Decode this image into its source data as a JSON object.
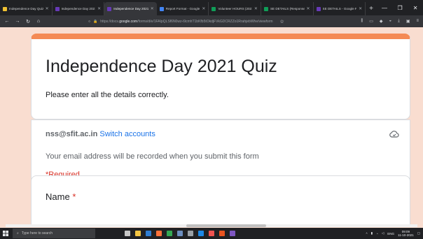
{
  "browser": {
    "tabs": [
      {
        "label": "Independence Day Quiz",
        "color": "#f1c232",
        "active": false
      },
      {
        "label": "Independence Day 2021",
        "color": "#673ab7",
        "active": false
      },
      {
        "label": "Independence Day 2021",
        "color": "#673ab7",
        "active": true
      },
      {
        "label": "Report Format - Google",
        "color": "#4285f4",
        "active": false
      },
      {
        "label": "Volunteer HOURS (2021",
        "color": "#0f9d58",
        "active": false
      },
      {
        "label": "SE DETAILS (Response",
        "color": "#0f9d58",
        "active": false
      },
      {
        "label": "SE DETAILS - Google Fo",
        "color": "#673ab7",
        "active": false
      }
    ],
    "new_tab": "+",
    "url_prefix": "https://docs.",
    "url_domain": "google.com",
    "url_rest": "/forms/d/e/1FAIpQLSf6N0wz-i9cmhT1bKfb5tOkdjFVkGDCRZZo1RrahjebWhe/viewform"
  },
  "form": {
    "title": "Independence Day 2021 Quiz",
    "subtitle": "Please enter all the details correctly.",
    "account_email": "nss@sfit.ac.in",
    "switch_accounts": "Switch accounts",
    "notice": "Your email address will be recorded when you submit this form",
    "required": "*Required",
    "question_label": "Name",
    "question_star": "*"
  },
  "taskbar": {
    "search_placeholder": "Type here to search",
    "lang": "ENG",
    "time": "09:09",
    "date": "11-10-2021"
  },
  "colors": {
    "accent": "#f48a54",
    "background": "#f9ddd0",
    "link": "#1a73e8",
    "required": "#d93025"
  }
}
